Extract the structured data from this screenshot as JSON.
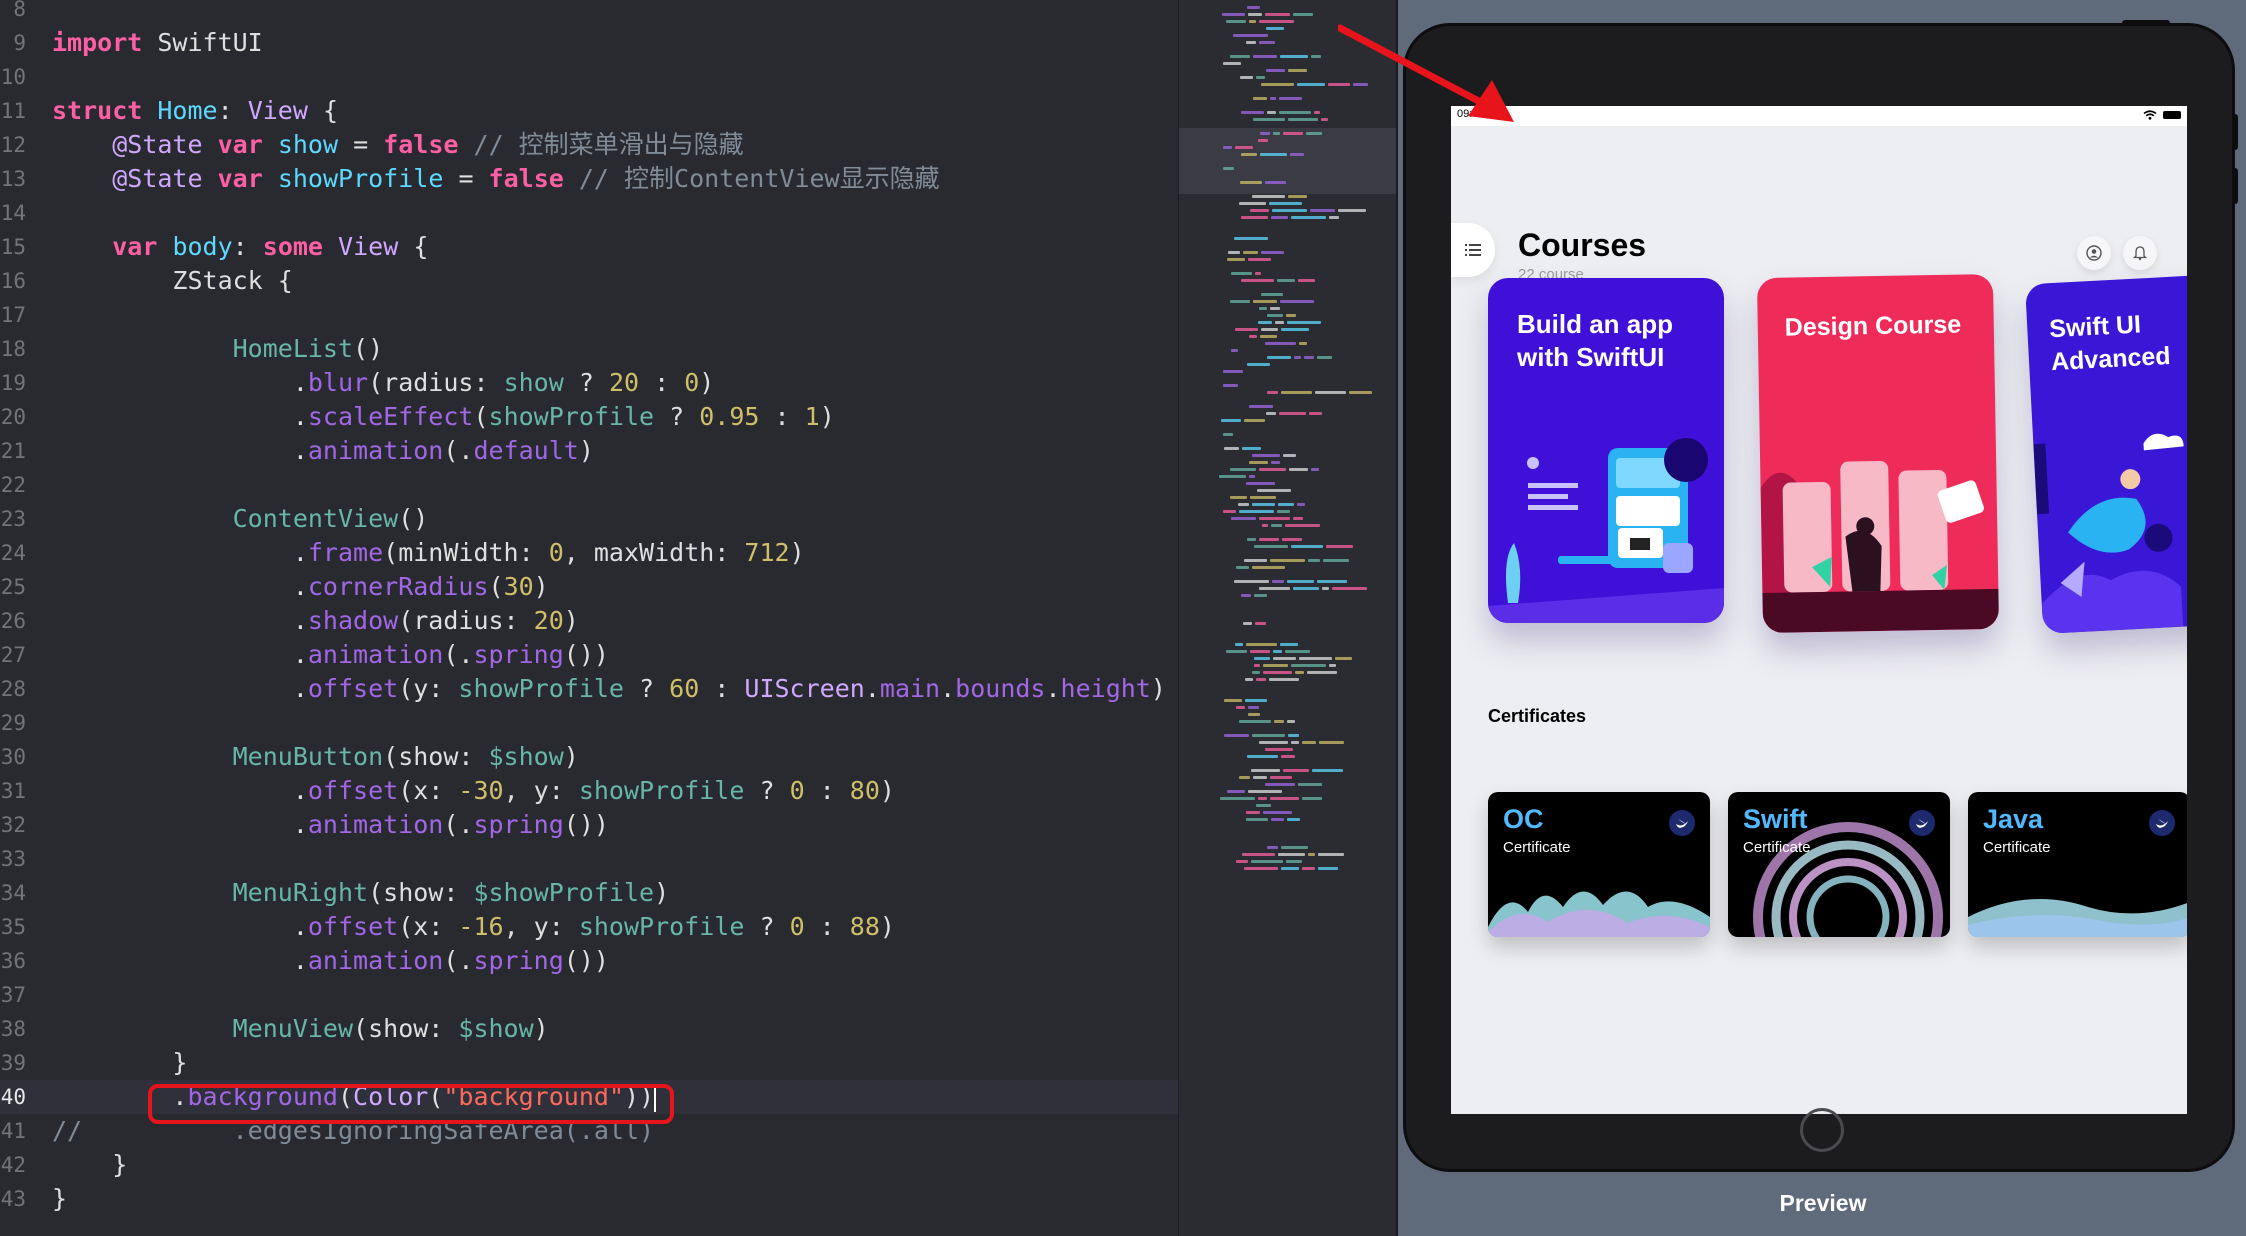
{
  "editor": {
    "current_line": "40",
    "lines": [
      {
        "n": "8",
        "tokens": []
      },
      {
        "n": "9",
        "tokens": [
          [
            "kw",
            "import"
          ],
          [
            "pl",
            " SwiftUI"
          ]
        ]
      },
      {
        "n": "10",
        "tokens": []
      },
      {
        "n": "11",
        "tokens": [
          [
            "kw",
            "struct"
          ],
          [
            "pl",
            " "
          ],
          [
            "ty",
            "Home"
          ],
          [
            "pl",
            ": "
          ],
          [
            "ty2",
            "View"
          ],
          [
            "pl",
            " {"
          ]
        ]
      },
      {
        "n": "12",
        "tokens": [
          [
            "pl",
            "    "
          ],
          [
            "ty2",
            "@State"
          ],
          [
            "pl",
            " "
          ],
          [
            "kw",
            "var"
          ],
          [
            "pl",
            " "
          ],
          [
            "ty",
            "show"
          ],
          [
            "pl",
            " = "
          ],
          [
            "kw",
            "false"
          ],
          [
            "pl",
            " "
          ],
          [
            "cm",
            "// 控制菜单滑出与隐藏"
          ]
        ]
      },
      {
        "n": "13",
        "tokens": [
          [
            "pl",
            "    "
          ],
          [
            "ty2",
            "@State"
          ],
          [
            "pl",
            " "
          ],
          [
            "kw",
            "var"
          ],
          [
            "pl",
            " "
          ],
          [
            "ty",
            "showProfile"
          ],
          [
            "pl",
            " = "
          ],
          [
            "kw",
            "false"
          ],
          [
            "pl",
            " "
          ],
          [
            "cm",
            "// 控制ContentView显示隐藏"
          ]
        ]
      },
      {
        "n": "14",
        "tokens": []
      },
      {
        "n": "15",
        "tokens": [
          [
            "pl",
            "    "
          ],
          [
            "kw",
            "var"
          ],
          [
            "pl",
            " "
          ],
          [
            "ty",
            "body"
          ],
          [
            "pl",
            ": "
          ],
          [
            "kw",
            "some"
          ],
          [
            "pl",
            " "
          ],
          [
            "ty2",
            "View"
          ],
          [
            "pl",
            " {"
          ]
        ]
      },
      {
        "n": "16",
        "tokens": [
          [
            "pl",
            "        ZStack {"
          ]
        ]
      },
      {
        "n": "17",
        "tokens": []
      },
      {
        "n": "18",
        "tokens": [
          [
            "pl",
            "            "
          ],
          [
            "fn",
            "HomeList"
          ],
          [
            "pl",
            "()"
          ]
        ]
      },
      {
        "n": "19",
        "tokens": [
          [
            "pl",
            "                ."
          ],
          [
            "mem",
            "blur"
          ],
          [
            "pl",
            "(radius: "
          ],
          [
            "fn",
            "show"
          ],
          [
            "pl",
            " ? "
          ],
          [
            "num",
            "20"
          ],
          [
            "pl",
            " : "
          ],
          [
            "num",
            "0"
          ],
          [
            "pl",
            ")"
          ]
        ]
      },
      {
        "n": "20",
        "tokens": [
          [
            "pl",
            "                ."
          ],
          [
            "mem",
            "scaleEffect"
          ],
          [
            "pl",
            "("
          ],
          [
            "fn",
            "showProfile"
          ],
          [
            "pl",
            " ? "
          ],
          [
            "num",
            "0.95"
          ],
          [
            "pl",
            " : "
          ],
          [
            "num",
            "1"
          ],
          [
            "pl",
            ")"
          ]
        ]
      },
      {
        "n": "21",
        "tokens": [
          [
            "pl",
            "                ."
          ],
          [
            "mem",
            "animation"
          ],
          [
            "pl",
            "(."
          ],
          [
            "mem",
            "default"
          ],
          [
            "pl",
            ")"
          ]
        ]
      },
      {
        "n": "22",
        "tokens": []
      },
      {
        "n": "23",
        "tokens": [
          [
            "pl",
            "            "
          ],
          [
            "fn",
            "ContentView"
          ],
          [
            "pl",
            "()"
          ]
        ]
      },
      {
        "n": "24",
        "tokens": [
          [
            "pl",
            "                ."
          ],
          [
            "mem",
            "frame"
          ],
          [
            "pl",
            "(minWidth: "
          ],
          [
            "num",
            "0"
          ],
          [
            "pl",
            ", maxWidth: "
          ],
          [
            "num",
            "712"
          ],
          [
            "pl",
            ")"
          ]
        ]
      },
      {
        "n": "25",
        "tokens": [
          [
            "pl",
            "                ."
          ],
          [
            "mem",
            "cornerRadius"
          ],
          [
            "pl",
            "("
          ],
          [
            "num",
            "30"
          ],
          [
            "pl",
            ")"
          ]
        ]
      },
      {
        "n": "26",
        "tokens": [
          [
            "pl",
            "                ."
          ],
          [
            "mem",
            "shadow"
          ],
          [
            "pl",
            "(radius: "
          ],
          [
            "num",
            "20"
          ],
          [
            "pl",
            ")"
          ]
        ]
      },
      {
        "n": "27",
        "tokens": [
          [
            "pl",
            "                ."
          ],
          [
            "mem",
            "animation"
          ],
          [
            "pl",
            "(."
          ],
          [
            "mem",
            "spring"
          ],
          [
            "pl",
            "())"
          ]
        ]
      },
      {
        "n": "28",
        "tokens": [
          [
            "pl",
            "                ."
          ],
          [
            "mem",
            "offset"
          ],
          [
            "pl",
            "(y: "
          ],
          [
            "fn",
            "showProfile"
          ],
          [
            "pl",
            " ? "
          ],
          [
            "num",
            "60"
          ],
          [
            "pl",
            " : "
          ],
          [
            "ty2",
            "UIScreen"
          ],
          [
            "pl",
            "."
          ],
          [
            "mem",
            "main"
          ],
          [
            "pl",
            "."
          ],
          [
            "mem",
            "bounds"
          ],
          [
            "pl",
            "."
          ],
          [
            "mem",
            "height"
          ],
          [
            "pl",
            ")"
          ]
        ]
      },
      {
        "n": "29",
        "tokens": []
      },
      {
        "n": "30",
        "tokens": [
          [
            "pl",
            "            "
          ],
          [
            "fn",
            "MenuButton"
          ],
          [
            "pl",
            "(show: "
          ],
          [
            "fn",
            "$show"
          ],
          [
            "pl",
            ")"
          ]
        ]
      },
      {
        "n": "31",
        "tokens": [
          [
            "pl",
            "                ."
          ],
          [
            "mem",
            "offset"
          ],
          [
            "pl",
            "(x: "
          ],
          [
            "num",
            "-30"
          ],
          [
            "pl",
            ", y: "
          ],
          [
            "fn",
            "showProfile"
          ],
          [
            "pl",
            " ? "
          ],
          [
            "num",
            "0"
          ],
          [
            "pl",
            " : "
          ],
          [
            "num",
            "80"
          ],
          [
            "pl",
            ")"
          ]
        ]
      },
      {
        "n": "32",
        "tokens": [
          [
            "pl",
            "                ."
          ],
          [
            "mem",
            "animation"
          ],
          [
            "pl",
            "(."
          ],
          [
            "mem",
            "spring"
          ],
          [
            "pl",
            "())"
          ]
        ]
      },
      {
        "n": "33",
        "tokens": []
      },
      {
        "n": "34",
        "tokens": [
          [
            "pl",
            "            "
          ],
          [
            "fn",
            "MenuRight"
          ],
          [
            "pl",
            "(show: "
          ],
          [
            "fn",
            "$showProfile"
          ],
          [
            "pl",
            ")"
          ]
        ]
      },
      {
        "n": "35",
        "tokens": [
          [
            "pl",
            "                ."
          ],
          [
            "mem",
            "offset"
          ],
          [
            "pl",
            "(x: "
          ],
          [
            "num",
            "-16"
          ],
          [
            "pl",
            ", y: "
          ],
          [
            "fn",
            "showProfile"
          ],
          [
            "pl",
            " ? "
          ],
          [
            "num",
            "0"
          ],
          [
            "pl",
            " : "
          ],
          [
            "num",
            "88"
          ],
          [
            "pl",
            ")"
          ]
        ]
      },
      {
        "n": "36",
        "tokens": [
          [
            "pl",
            "                ."
          ],
          [
            "mem",
            "animation"
          ],
          [
            "pl",
            "(."
          ],
          [
            "mem",
            "spring"
          ],
          [
            "pl",
            "())"
          ]
        ]
      },
      {
        "n": "37",
        "tokens": []
      },
      {
        "n": "38",
        "tokens": [
          [
            "pl",
            "            "
          ],
          [
            "fn",
            "MenuView"
          ],
          [
            "pl",
            "(show: "
          ],
          [
            "fn",
            "$show"
          ],
          [
            "pl",
            ")"
          ]
        ]
      },
      {
        "n": "39",
        "tokens": [
          [
            "pl",
            "        }"
          ]
        ]
      },
      {
        "n": "40",
        "tokens": [
          [
            "pl",
            "        ."
          ],
          [
            "mem",
            "background"
          ],
          [
            "pl",
            "("
          ],
          [
            "ty2",
            "Color"
          ],
          [
            "pl",
            "("
          ],
          [
            "str",
            "\"background\""
          ],
          [
            "pl",
            "))"
          ]
        ]
      },
      {
        "n": "41",
        "tokens": [
          [
            "cm",
            "//          .edgesIgnoringSafeArea(.all)"
          ]
        ]
      },
      {
        "n": "42",
        "tokens": [
          [
            "pl",
            "    }"
          ]
        ]
      },
      {
        "n": "43",
        "tokens": [
          [
            "pl",
            "}"
          ]
        ]
      }
    ]
  },
  "preview": {
    "label": "Preview",
    "status_time": "09:4",
    "app": {
      "title": "Courses",
      "subtitle": "22 course",
      "courses": [
        {
          "title": "Build an app with SwiftUI",
          "color": "#3f10d8"
        },
        {
          "title": "Design Course",
          "color": "#ef2b5a"
        },
        {
          "title": "Swift UI Advanced",
          "color": "#3a16d6"
        }
      ],
      "certificates_label": "Certificates",
      "certificates": [
        {
          "name": "OC",
          "sub": "Certificate"
        },
        {
          "name": "Swift",
          "sub": "Certificate"
        },
        {
          "name": "Java",
          "sub": "Certificate"
        }
      ]
    }
  },
  "colors": {
    "editor_bg": "#292a30",
    "keyword": "#fc5fa3",
    "type": "#5dd8ff",
    "type_other": "#d0a8ff",
    "function": "#67b7a4",
    "member": "#a167e6",
    "number": "#d0bf69",
    "string": "#fc6a5d",
    "comment": "#7f8c98",
    "highlight_box": "#e8141b"
  }
}
